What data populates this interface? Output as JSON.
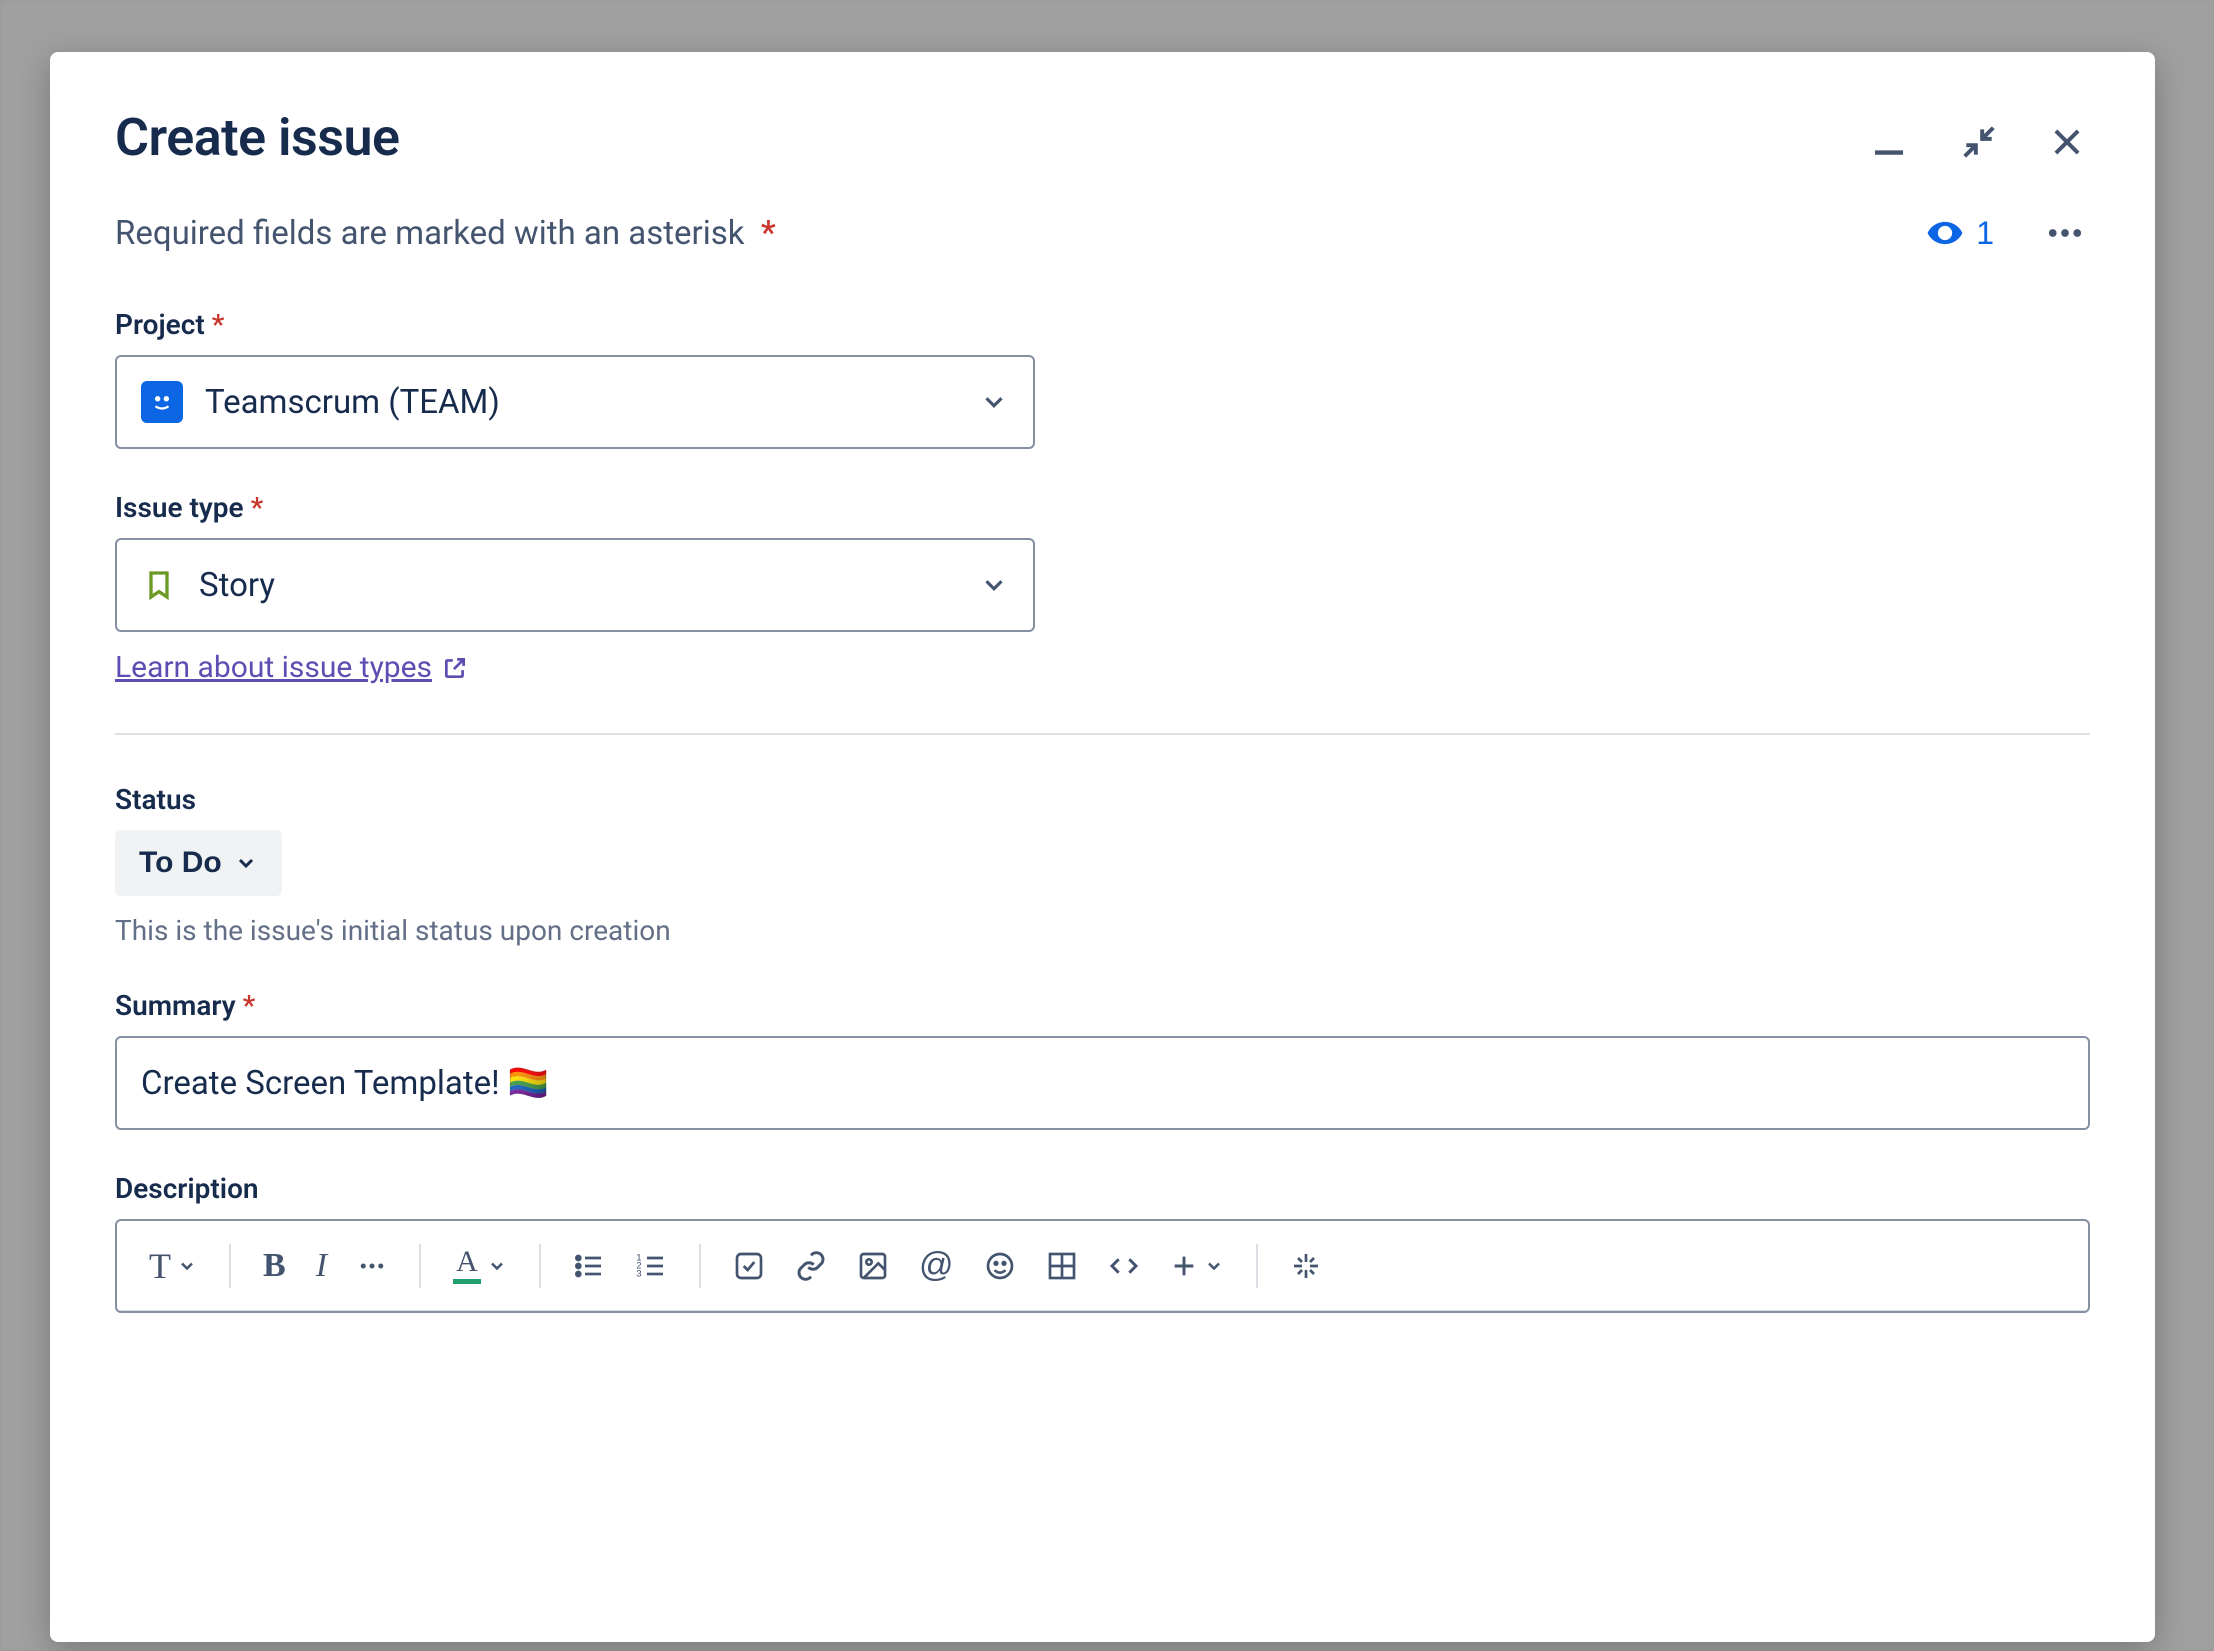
{
  "modal": {
    "title": "Create issue",
    "required_note": "Required fields are marked with an asterisk",
    "watchers_count": "1"
  },
  "fields": {
    "project": {
      "label": "Project",
      "value": "Teamscrum (TEAM)"
    },
    "issue_type": {
      "label": "Issue type",
      "value": "Story",
      "learn_link": "Learn about issue types"
    },
    "status": {
      "label": "Status",
      "value": "To Do",
      "helper": "This is the issue's initial status upon creation"
    },
    "summary": {
      "label": "Summary",
      "value": "Create Screen Template! 🏳️‍🌈"
    },
    "description": {
      "label": "Description"
    }
  }
}
